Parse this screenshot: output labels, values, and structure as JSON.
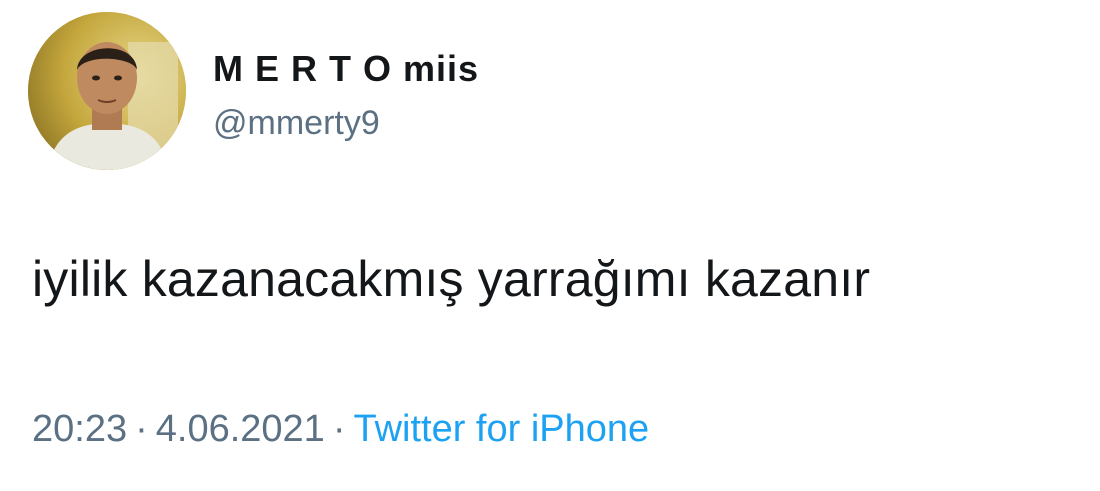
{
  "author": {
    "display_name": "M E R T O miis",
    "handle": "@mmerty9",
    "avatar_icon": "profile-photo"
  },
  "tweet": {
    "text": "iyilik kazanacakmış yarrağımı kazanır",
    "time": "20:23",
    "date": "4.06.2021",
    "separator": "·",
    "source": "Twitter for iPhone"
  },
  "colors": {
    "text": "#14171a",
    "secondary": "#5b7083",
    "link": "#1da1f2"
  }
}
